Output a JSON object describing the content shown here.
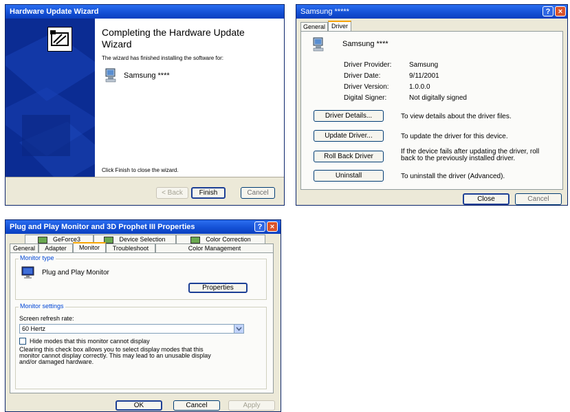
{
  "wizard": {
    "title": "Hardware Update Wizard",
    "heading_line1": "Completing the Hardware Update",
    "heading_line2": "Wizard",
    "finished_text": "The wizard has finished installing the software for:",
    "device_name": "Samsung ****",
    "close_hint": "Click Finish to close the wizard.",
    "back_label": "< Back",
    "finish_label": "Finish",
    "cancel_label": "Cancel"
  },
  "driver_dialog": {
    "title": "Samsung *****",
    "help_glyph": "?",
    "close_glyph": "×",
    "tabs": [
      "General",
      "Driver"
    ],
    "active_tab": "Driver",
    "device_name": "Samsung ****",
    "props": [
      {
        "label": "Driver Provider:",
        "value": "Samsung"
      },
      {
        "label": "Driver Date:",
        "value": "9/11/2001"
      },
      {
        "label": "Driver Version:",
        "value": "1.0.0.0"
      },
      {
        "label": "Digital Signer:",
        "value": "Not digitally signed"
      }
    ],
    "actions": [
      {
        "button": "Driver Details...",
        "desc1": "To view details about the driver files.",
        "desc2": ""
      },
      {
        "button": "Update Driver...",
        "desc1": "To update the driver for this device.",
        "desc2": ""
      },
      {
        "button": "Roll Back Driver",
        "desc1": "If the device fails after updating the driver, roll",
        "desc2": "back to the previously installed driver."
      },
      {
        "button": "Uninstall",
        "desc1": "To uninstall the driver (Advanced).",
        "desc2": ""
      }
    ],
    "close_label": "Close",
    "cancel_label": "Cancel"
  },
  "monitor_dialog": {
    "title": "Plug and Play Monitor and 3D Prophet III Properties",
    "help_glyph": "?",
    "close_glyph": "×",
    "tabs_row1": [
      "GeForce3",
      "Device Selection",
      "Color Correction"
    ],
    "tabs_row2": [
      "General",
      "Adapter",
      "Monitor",
      "Troubleshoot",
      "Color Management"
    ],
    "active_tab": "Monitor",
    "monitor_type_label": "Monitor type",
    "monitor_name": "Plug and Play Monitor",
    "properties_label": "Properties",
    "monitor_settings_label": "Monitor settings",
    "refresh_label": "Screen refresh rate:",
    "refresh_value": "60 Hertz",
    "hide_modes_label": "Hide modes that this monitor cannot display",
    "hide_modes_checked": false,
    "description_lines": [
      "Clearing this check box allows you to select display modes that this",
      "monitor cannot display correctly. This may lead to an unusable display",
      "and/or damaged hardware."
    ],
    "ok_label": "OK",
    "cancel_label": "Cancel",
    "apply_label": "Apply"
  }
}
